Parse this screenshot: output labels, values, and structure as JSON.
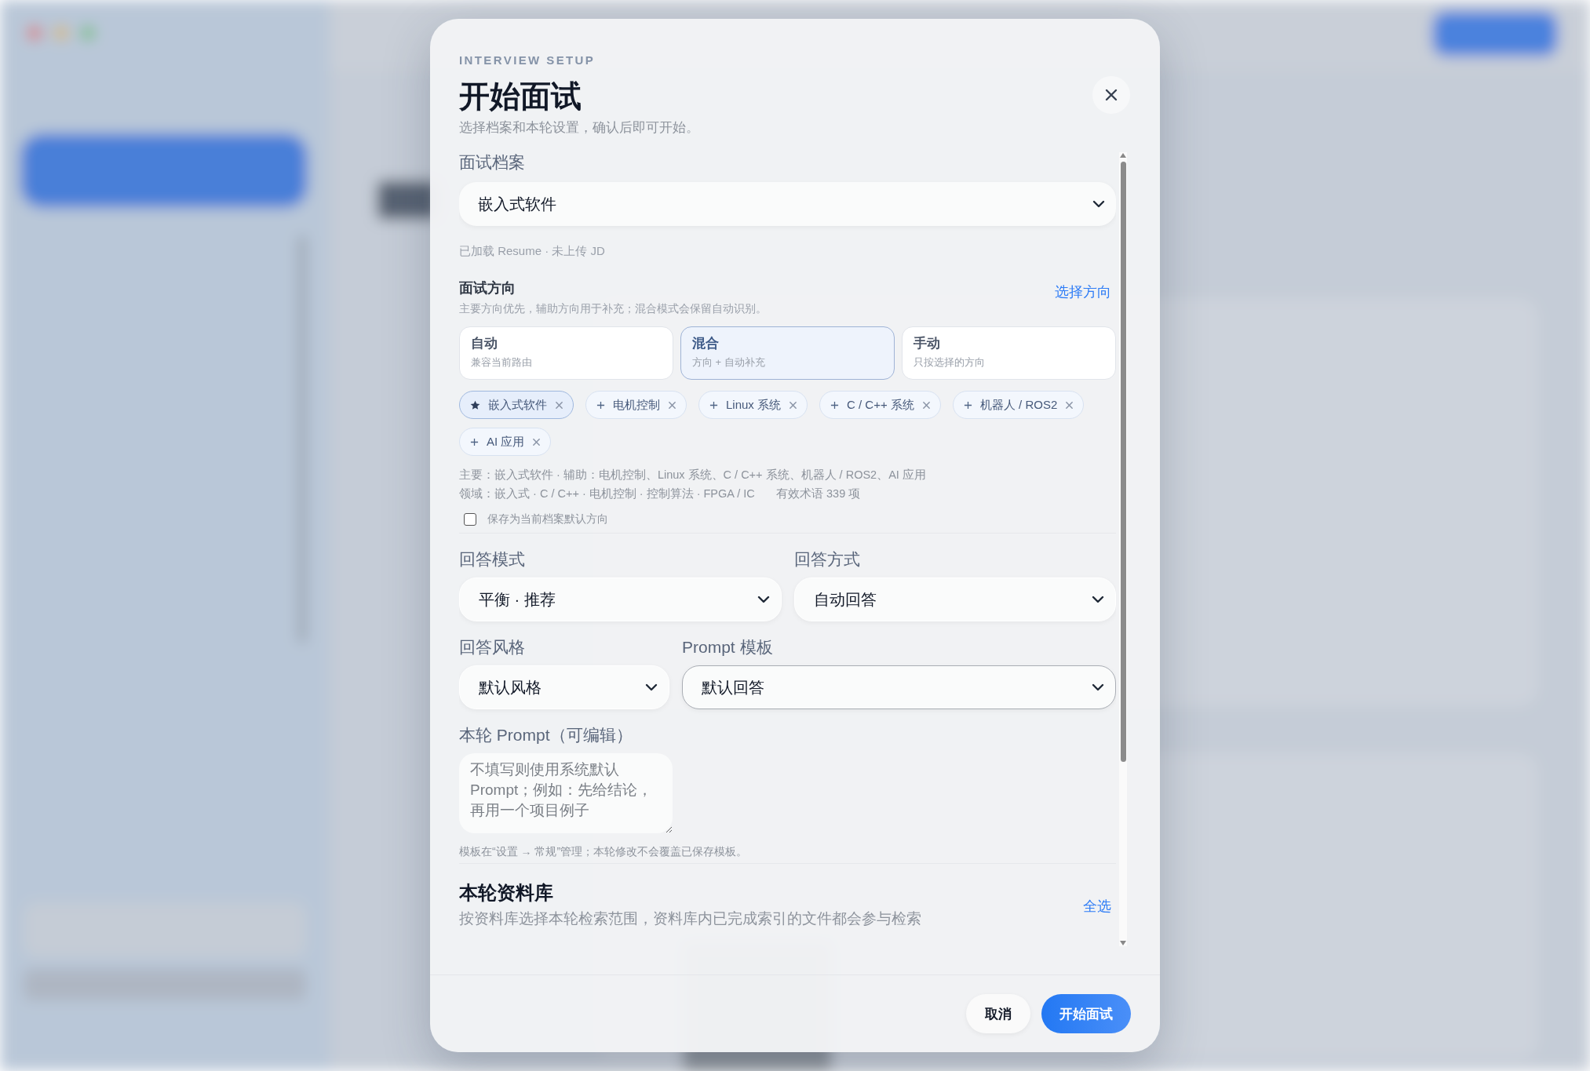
{
  "dialog": {
    "eyebrow": "INTERVIEW SETUP",
    "title": "开始面试",
    "subtitle": "选择档案和本轮设置，确认后即可开始。"
  },
  "profile": {
    "label": "面试档案",
    "value": "嵌入式软件",
    "status": "已加载 Resume · 未上传 JD"
  },
  "direction": {
    "title": "面试方向",
    "description": "主要方向优先，辅助方向用于补充；混合模式会保留自动识别。",
    "link": "选择方向",
    "modes": [
      {
        "title": "自动",
        "subtitle": "兼容当前路由",
        "selected": false
      },
      {
        "title": "混合",
        "subtitle": "方向 + 自动补充",
        "selected": true
      },
      {
        "title": "手动",
        "subtitle": "只按选择的方向",
        "selected": false
      }
    ],
    "chips": [
      {
        "label": "嵌入式软件",
        "kind": "primary"
      },
      {
        "label": "电机控制",
        "kind": "secondary"
      },
      {
        "label": "Linux 系统",
        "kind": "secondary"
      },
      {
        "label": "C / C++ 系统",
        "kind": "secondary"
      },
      {
        "label": "机器人 / ROS2",
        "kind": "secondary"
      },
      {
        "label": "AI 应用",
        "kind": "secondary"
      }
    ],
    "summary": [
      "主要：嵌入式软件 · 辅助：电机控制、Linux 系统、C / C++ 系统、机器人 / ROS2、AI 应用",
      "领域：嵌入式 · C / C++ · 电机控制 · 控制算法 · FPGA / IC"
    ],
    "term_count": "有效术语 339 项",
    "save_default": {
      "label": "保存为当前档案默认方向",
      "checked": false
    }
  },
  "settings": [
    {
      "label": "回答模式",
      "value": "平衡 · 推荐",
      "focused": false
    },
    {
      "label": "回答方式",
      "value": "自动回答",
      "focused": false
    },
    {
      "label": "回答风格",
      "value": "默认风格",
      "focused": false
    },
    {
      "label": "Prompt 模板",
      "value": "默认回答",
      "focused": true
    }
  ],
  "prompt": {
    "label": "本轮 Prompt（可编辑）",
    "placeholder": "不填写则使用系统默认Prompt；例如：先给结论，再用一个项目例子",
    "note": "模板在“设置 → 常规”管理；本轮修改不会覆盖已保存模板。"
  },
  "library": {
    "title": "本轮资料库",
    "description": "按资料库选择本轮检索范围，资料库内已完成索引的文件都会参与检索",
    "link": "全选"
  },
  "buttons": [
    {
      "label": "取消",
      "kind": "secondary"
    },
    {
      "label": "开始面试",
      "kind": "primary"
    }
  ]
}
